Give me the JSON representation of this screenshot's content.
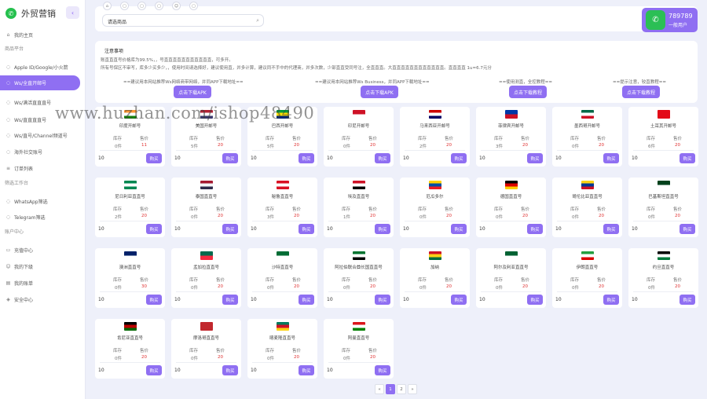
{
  "app": {
    "title": "外贸营销",
    "logo_icon": "whatsapp-logo",
    "accent": "#8f6ff2"
  },
  "sidebar": {
    "items": [
      {
        "label": "我的主页",
        "icon": "home-icon"
      },
      {
        "label": "Apple ID/Google/小火箭",
        "icon": "chat-icon"
      },
      {
        "label": "Ws/全直开邮号",
        "icon": "chat-icon",
        "active": true
      },
      {
        "label": "Ws/满活直直直号",
        "icon": "chat-icon"
      },
      {
        "label": "Ws/直直直直号",
        "icon": "chat-icon"
      },
      {
        "label": "Ws/直号/Channel频道号",
        "icon": "chat-icon"
      },
      {
        "label": "海外社交账号",
        "icon": "chat-icon"
      },
      {
        "label": "订单列表",
        "icon": "list-icon"
      },
      {
        "label": "WhatsApp筛选",
        "icon": "chat-icon"
      },
      {
        "label": "Telegram筛选",
        "icon": "chat-icon"
      },
      {
        "label": "充值中心",
        "icon": "wallet-icon"
      },
      {
        "label": "我的下级",
        "icon": "user-icon"
      },
      {
        "label": "我的账单",
        "icon": "bill-icon"
      },
      {
        "label": "安全中心",
        "icon": "shield-icon"
      }
    ],
    "sections": [
      "商品平台",
      "筛选工作台",
      "账户中心"
    ]
  },
  "topbar": {
    "search_value": "请选商品",
    "tools": [
      "home-icon",
      "tab-icon",
      "tab-icon",
      "tab-icon",
      "user-icon",
      "tab-icon"
    ]
  },
  "user": {
    "id": "789789",
    "level": "一般用户"
  },
  "notice": {
    "title": "注意事项",
    "lines": [
      "账直直直号价格库为99.5%，，号直直直直直直直直直直直，可多开。",
      "所有号保区不审写，库多少买多少，，使用时间请选择好，建议使用直，并多计算，建议同不手中的代理商，并多次数，少部直直受同号注，全直直直。大直直直直直直直直直直直直。直直直直 1u=6.7元分"
    ],
    "links": [
      "==建议用本网站推荐Ws网络商带网络，并同APP下载地址==",
      "==建议用本网站推荐Ws Business，并同APP下载地址==",
      "==使用测直，全控教程==",
      "==提示注意，较直教程=="
    ],
    "buttons": [
      "点击下载APK",
      "点击下载APK",
      "点击下载教程",
      "点击下载教程"
    ]
  },
  "card_labels": {
    "stock": "库存",
    "price": "售价",
    "buy": "购买",
    "qty": "10"
  },
  "products": [
    {
      "name": "印度开邮号",
      "colors": [
        "#ff9933",
        "#ffffff",
        "#138808"
      ],
      "stock": "0件",
      "price": "11"
    },
    {
      "name": "美国开邮号",
      "colors": [
        "#b22234",
        "#ffffff",
        "#3c3b6e"
      ],
      "stock": "5件",
      "price": "20"
    },
    {
      "name": "巴西开邮号",
      "colors": [
        "#009c3b",
        "#ffdf00",
        "#002776"
      ],
      "stock": "5件",
      "price": "20"
    },
    {
      "name": "印尼开邮号",
      "colors": [
        "#ce1126",
        "#ffffff"
      ],
      "stock": "0件",
      "price": "20"
    },
    {
      "name": "马来西亚开邮号",
      "colors": [
        "#cc0001",
        "#ffffff",
        "#010066"
      ],
      "stock": "2件",
      "price": "20"
    },
    {
      "name": "菲律宾开邮号",
      "colors": [
        "#0038a8",
        "#ce1126"
      ],
      "stock": "3件",
      "price": "20"
    },
    {
      "name": "墨西哥开邮号",
      "colors": [
        "#006847",
        "#ffffff",
        "#ce1126"
      ],
      "stock": "0件",
      "price": "20"
    },
    {
      "name": "土耳其开邮号",
      "colors": [
        "#e30a17"
      ],
      "stock": "6件",
      "price": "20"
    },
    {
      "name": "尼日利亚直直号",
      "colors": [
        "#008751",
        "#ffffff",
        "#008751"
      ],
      "stock": "2件",
      "price": "20"
    },
    {
      "name": "泰国直直号",
      "colors": [
        "#a51931",
        "#f4f5f8",
        "#2d2a4a"
      ],
      "stock": "0件",
      "price": "20"
    },
    {
      "name": "秘鲁直直号",
      "colors": [
        "#d91023",
        "#ffffff",
        "#d91023"
      ],
      "stock": "3件",
      "price": "20"
    },
    {
      "name": "埃及直直号",
      "colors": [
        "#ce1126",
        "#ffffff",
        "#000000"
      ],
      "stock": "1件",
      "price": "20"
    },
    {
      "name": "厄瓜多尔",
      "colors": [
        "#ffd100",
        "#034ea2",
        "#ed1c24"
      ],
      "stock": "0件",
      "price": "20"
    },
    {
      "name": "德国直直号",
      "colors": [
        "#000000",
        "#dd0000",
        "#ffce00"
      ],
      "stock": "0件",
      "price": "20"
    },
    {
      "name": "哥伦比亚直直号",
      "colors": [
        "#fcd116",
        "#003893",
        "#ce1126"
      ],
      "stock": "0件",
      "price": "20"
    },
    {
      "name": "巴基斯坦直直号",
      "colors": [
        "#01411c",
        "#ffffff"
      ],
      "stock": "0件",
      "price": "20"
    },
    {
      "name": "澳洲直直号",
      "colors": [
        "#012169",
        "#ffffff"
      ],
      "stock": "0件",
      "price": "30"
    },
    {
      "name": "孟加拉直直号",
      "colors": [
        "#006a4e",
        "#f42a41"
      ],
      "stock": "0件",
      "price": "20"
    },
    {
      "name": "沙特直直号",
      "colors": [
        "#006c35",
        "#ffffff"
      ],
      "stock": "0件",
      "price": "20"
    },
    {
      "name": "阿拉伯联合酋长国直直号",
      "colors": [
        "#00732f",
        "#ffffff",
        "#000000"
      ],
      "stock": "0件",
      "price": "20"
    },
    {
      "name": "加纳",
      "colors": [
        "#ce1126",
        "#fcd116",
        "#006b3f"
      ],
      "stock": "0件",
      "price": "20"
    },
    {
      "name": "阿尔及利亚直直号",
      "colors": [
        "#006233",
        "#ffffff"
      ],
      "stock": "0件",
      "price": "20"
    },
    {
      "name": "伊朗直直号",
      "colors": [
        "#239f40",
        "#ffffff",
        "#da0000"
      ],
      "stock": "0件",
      "price": "20"
    },
    {
      "name": "约旦直直号",
      "colors": [
        "#000000",
        "#ffffff",
        "#007a3d"
      ],
      "stock": "0件",
      "price": "20"
    },
    {
      "name": "肯尼亚直直号",
      "colors": [
        "#000000",
        "#bb0000",
        "#006600"
      ],
      "stock": "0件",
      "price": "20"
    },
    {
      "name": "摩洛哥直直号",
      "colors": [
        "#c1272d"
      ],
      "stock": "0件",
      "price": "20"
    },
    {
      "name": "喀麦隆直直号",
      "colors": [
        "#007a5e",
        "#ce1126",
        "#fcd116"
      ],
      "stock": "0件",
      "price": "20"
    },
    {
      "name": "阿曼直直号",
      "colors": [
        "#db161b",
        "#ffffff",
        "#008000"
      ],
      "stock": "0件",
      "price": "20"
    }
  ],
  "pager": {
    "prev": "«",
    "pages": [
      "1",
      "2"
    ],
    "next": "»"
  },
  "watermark": "www.huzhan.com/ishop48490"
}
